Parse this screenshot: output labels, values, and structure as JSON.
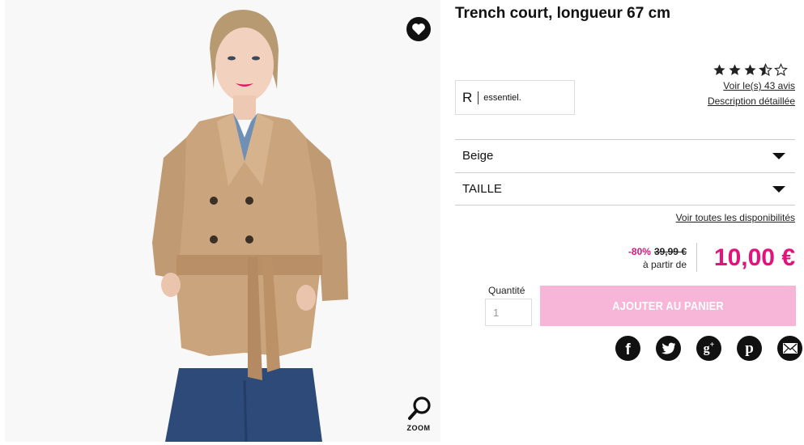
{
  "product": {
    "title": "Trench court, longueur 67 cm",
    "image_alt": "Femme portant un trench court beige",
    "zoom_label": "ZOOM",
    "rating": 3.5,
    "rating_max": 5,
    "reviews_link": "Voir le(s) 43 avis",
    "description_link": "Description détaillée"
  },
  "brand": {
    "logo_letter": "R",
    "logo_name": "essentiel."
  },
  "options": {
    "color_selected": "Beige",
    "size_placeholder": "TAILLE",
    "availability_link": "Voir toutes les disponibilités"
  },
  "pricing": {
    "discount": "-80%",
    "old_price": "39,99 €",
    "from_label": "à partir de",
    "price": "10,00 €",
    "accent_color": "#e3137b"
  },
  "cart": {
    "quantity_label": "Quantité",
    "quantity_value": "1",
    "add_to_cart_label": "AJOUTER AU PANIER",
    "button_color": "#f7b5d8"
  },
  "share": {
    "icons": [
      "facebook-icon",
      "twitter-icon",
      "google-plus-icon",
      "pinterest-icon",
      "email-icon"
    ]
  }
}
